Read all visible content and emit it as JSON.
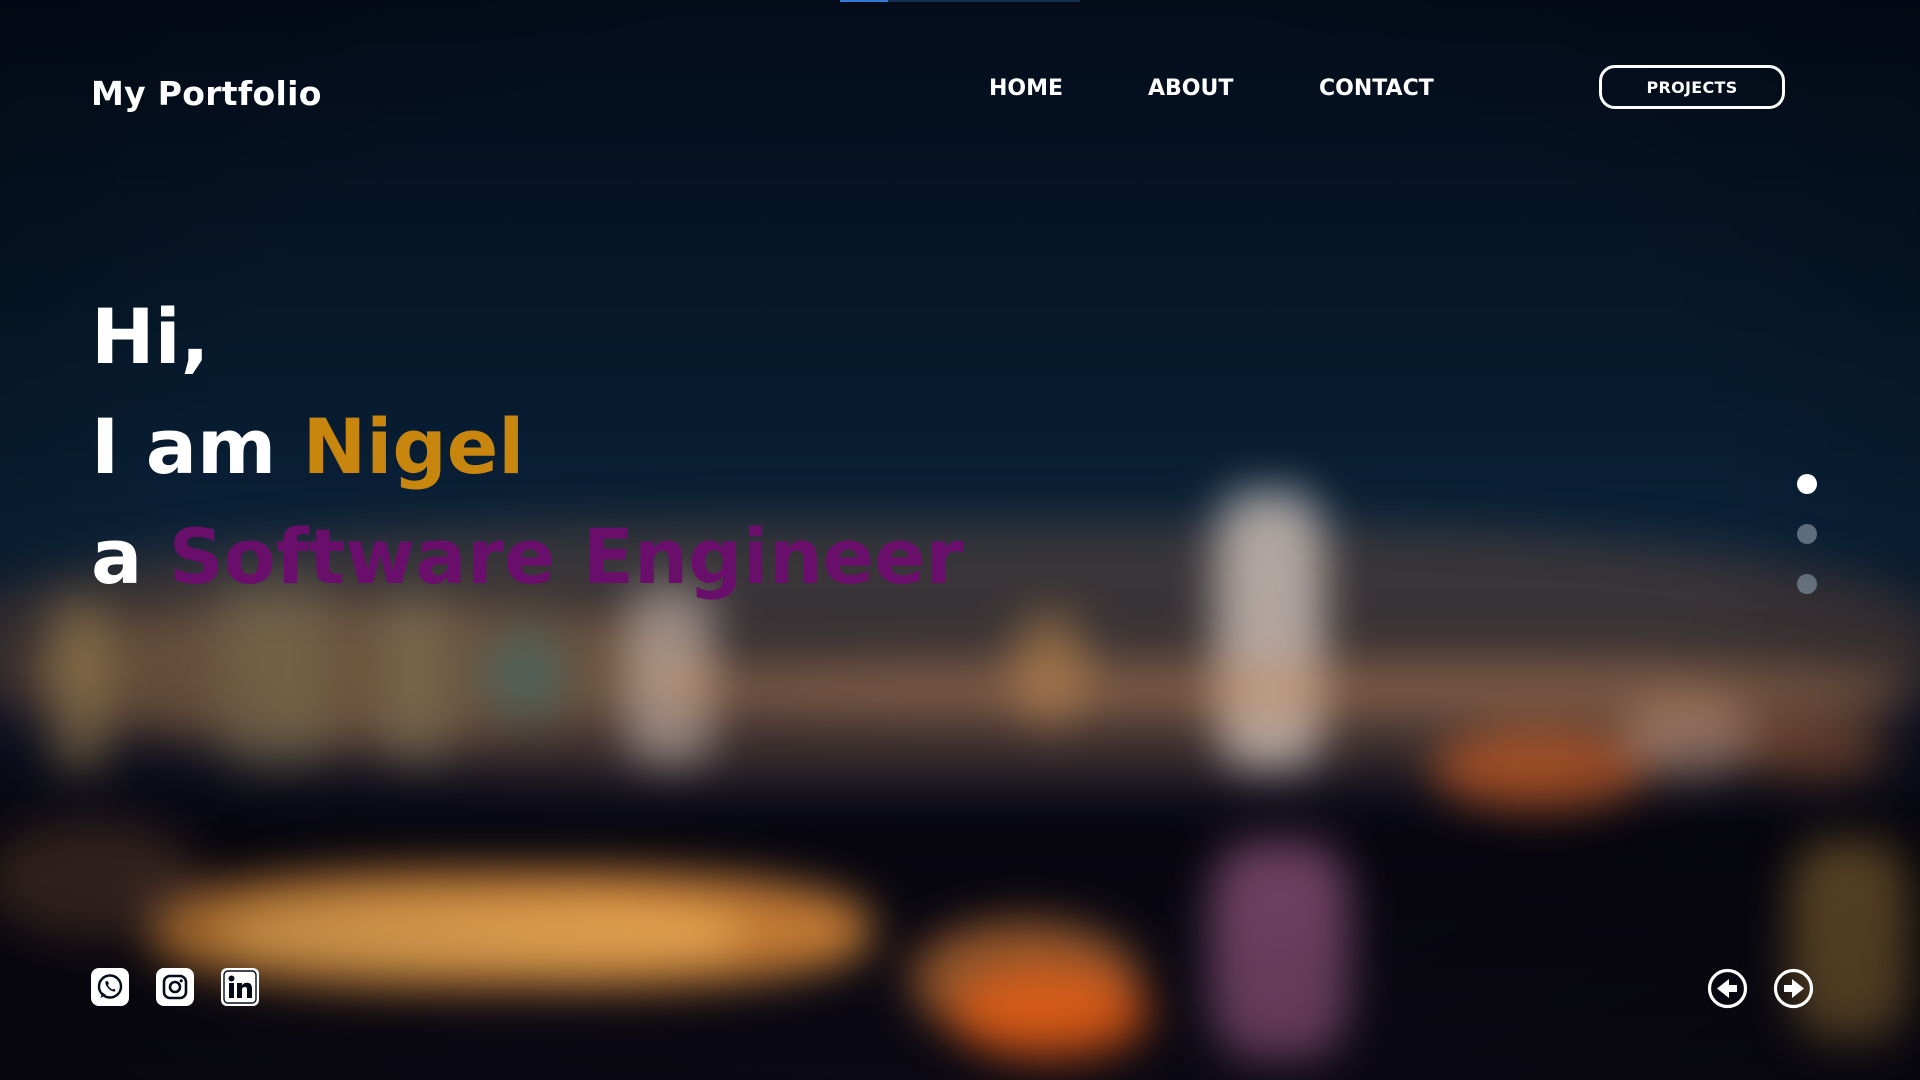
{
  "header": {
    "logo": "My Portfolio",
    "nav": {
      "home": "HOME",
      "about": "ABOUT",
      "contact": "CONTACT"
    },
    "projects_button": "PROJECTS"
  },
  "hero": {
    "line1": "Hi,",
    "line2_prefix": "I am ",
    "name": "Nigel",
    "line3_prefix": "a ",
    "role": "Software Engineer"
  },
  "slider": {
    "slide_count": 3,
    "active_slide": 1
  },
  "social": {
    "icons": [
      "whatsapp-icon",
      "instagram-icon",
      "linkedin-icon"
    ]
  },
  "navigation_arrows": {
    "icons": [
      "arrow-left-circle-icon",
      "arrow-right-circle-icon"
    ]
  },
  "colors": {
    "name_accent": "#c8860f",
    "role_accent": "#6a0e6b",
    "text": "#ffffff",
    "background": "#030a18"
  }
}
